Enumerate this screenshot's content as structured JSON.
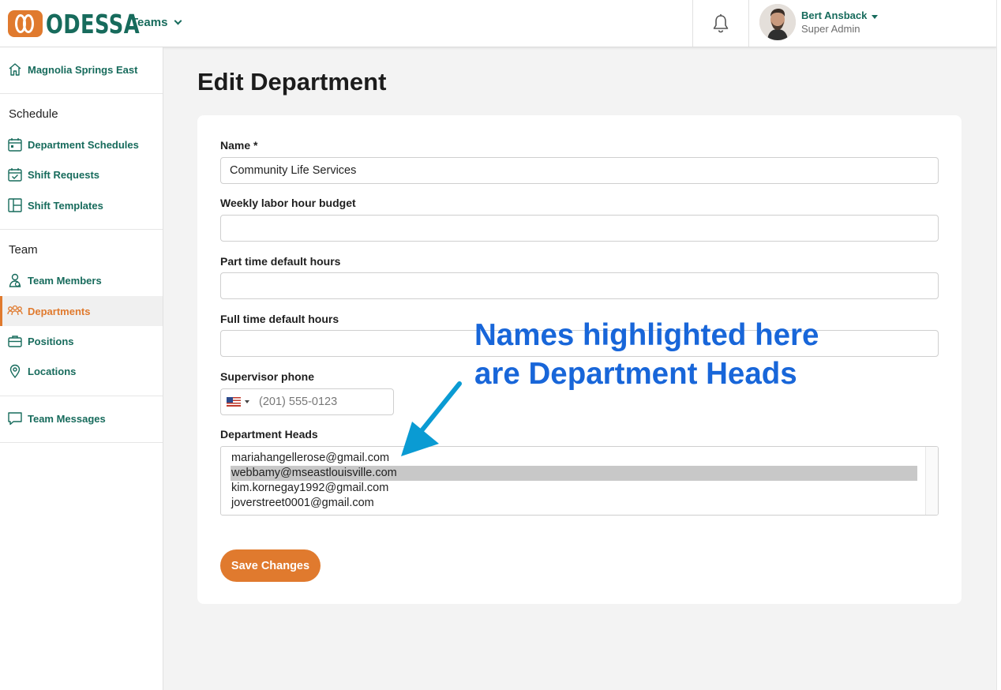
{
  "brand": {
    "name": "ODESSA",
    "color": "#176b5c",
    "accent": "#e07a2e"
  },
  "header": {
    "teams_label": "Teams",
    "user": {
      "name": "Bert Ansback",
      "role": "Super Admin"
    }
  },
  "sidebar": {
    "location": "Magnolia Springs East",
    "schedule_heading": "Schedule",
    "schedule_items": [
      {
        "label": "Department Schedules",
        "icon": "calendar-icon"
      },
      {
        "label": "Shift Requests",
        "icon": "calendar-check-icon"
      },
      {
        "label": "Shift Templates",
        "icon": "template-icon"
      }
    ],
    "team_heading": "Team",
    "team_items": [
      {
        "label": "Team Members",
        "icon": "team-member-icon"
      },
      {
        "label": "Departments",
        "icon": "departments-icon",
        "active": true
      },
      {
        "label": "Positions",
        "icon": "briefcase-icon"
      },
      {
        "label": "Locations",
        "icon": "location-pin-icon"
      }
    ],
    "messages_label": "Team Messages"
  },
  "page": {
    "title": "Edit Department",
    "form": {
      "name_label": "Name *",
      "name_value": "Community Life Services",
      "budget_label": "Weekly labor hour budget",
      "budget_value": "",
      "part_time_label": "Part time default hours",
      "part_time_value": "",
      "full_time_label": "Full time default hours",
      "full_time_value": "",
      "phone_label": "Supervisor phone",
      "phone_placeholder": "(201) 555-0123",
      "heads_label": "Department Heads",
      "heads_options": [
        "mariahangellerose@gmail.com",
        "webbamy@mseastlouisville.com",
        "kim.kornegay1992@gmail.com",
        "joverstreet0001@gmail.com"
      ],
      "save_label": "Save Changes"
    }
  },
  "annotation": {
    "line1": "Names highlighted here",
    "line2": "are Department Heads",
    "color": "#1866d9",
    "arrow_color": "#0a9bd3"
  }
}
